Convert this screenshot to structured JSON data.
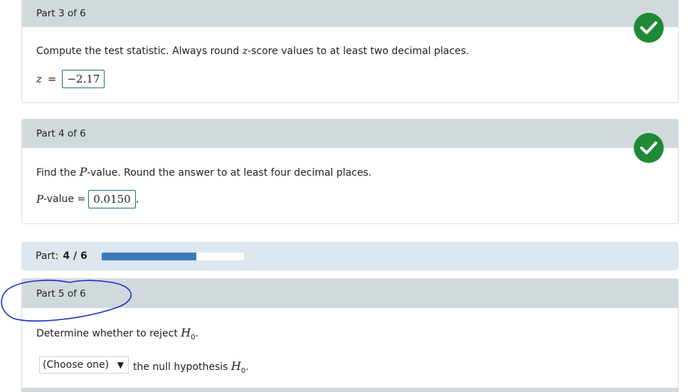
{
  "part3": {
    "header": "Part 3 of 6",
    "prompt_before": "Compute the test statistic. Always round ",
    "prompt_var": "z",
    "prompt_after": "-score values to at least two decimal places.",
    "answer_var": "z",
    "equals": "=",
    "answer_value": "−2.17",
    "status_icon": "check-icon"
  },
  "part4": {
    "header": "Part 4 of 6",
    "prompt_before": "Find the ",
    "prompt_var": "P",
    "prompt_after": "-value. Round the answer to at least four decimal places.",
    "answer_var": "P",
    "answer_label_suffix": "-value =",
    "answer_value": "0.0150",
    "answer_trailing": ".",
    "status_icon": "check-icon"
  },
  "progress": {
    "label": "Part:",
    "value_text": "4 / 6",
    "fraction": 0.6667,
    "bar_color": "#3e79b8"
  },
  "part5": {
    "header": "Part 5 of 6",
    "prompt_before": "Determine whether to reject ",
    "prompt_var": "H",
    "prompt_sub": "0",
    "prompt_after": ".",
    "select_value": "(Choose one)",
    "select_arrow": "▼",
    "after_select": "the null hypothesis ",
    "after_var": "H",
    "after_sub": "0",
    "after_end": "."
  },
  "colors": {
    "header_bg": "#d1d9dd",
    "check_green": "#1e8a35",
    "progress_bg": "#dce7f0",
    "annotation_blue": "#1a2fc4"
  }
}
